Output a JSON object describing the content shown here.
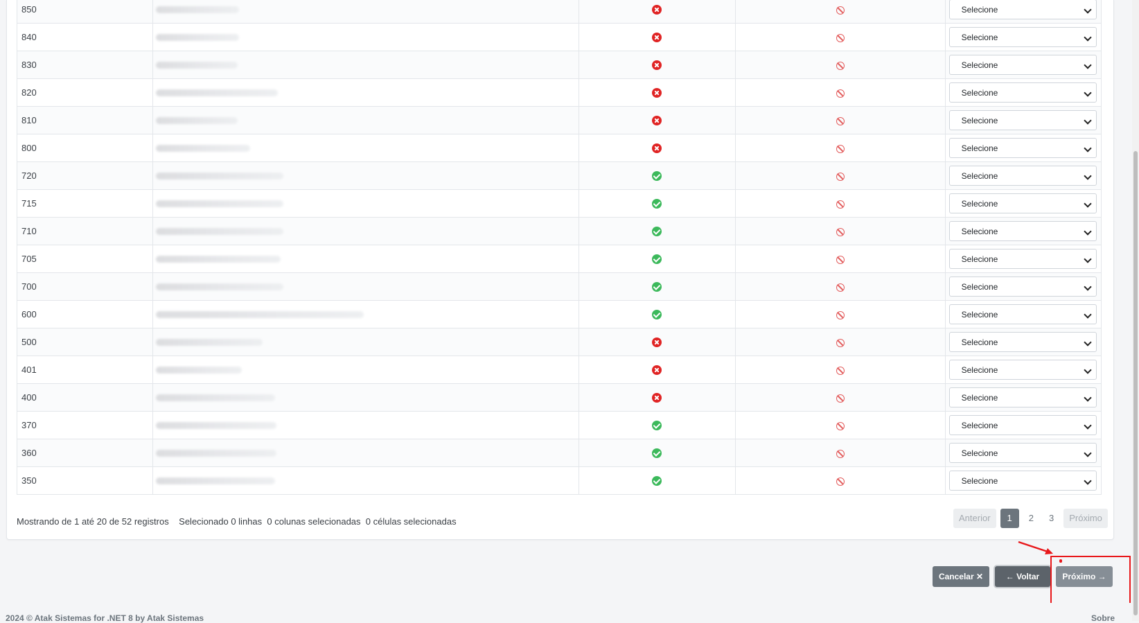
{
  "table": {
    "option_placeholder": "Selecione",
    "rows": [
      {
        "code": "850",
        "status": "error",
        "name_blur": 120
      },
      {
        "code": "840",
        "status": "error",
        "name_blur": 120
      },
      {
        "code": "830",
        "status": "error",
        "name_blur": 118
      },
      {
        "code": "820",
        "status": "error",
        "name_blur": 176
      },
      {
        "code": "810",
        "status": "error",
        "name_blur": 118
      },
      {
        "code": "800",
        "status": "error",
        "name_blur": 136
      },
      {
        "code": "720",
        "status": "ok",
        "name_blur": 184
      },
      {
        "code": "715",
        "status": "ok",
        "name_blur": 184
      },
      {
        "code": "710",
        "status": "ok",
        "name_blur": 184
      },
      {
        "code": "705",
        "status": "ok",
        "name_blur": 180
      },
      {
        "code": "700",
        "status": "ok",
        "name_blur": 184
      },
      {
        "code": "600",
        "status": "ok",
        "name_blur": 300
      },
      {
        "code": "500",
        "status": "error",
        "name_blur": 154
      },
      {
        "code": "401",
        "status": "error",
        "name_blur": 124
      },
      {
        "code": "400",
        "status": "error",
        "name_blur": 172
      },
      {
        "code": "370",
        "status": "ok",
        "name_blur": 174
      },
      {
        "code": "360",
        "status": "ok",
        "name_blur": 174
      },
      {
        "code": "350",
        "status": "ok",
        "name_blur": 172
      }
    ]
  },
  "info": {
    "showing": "Mostrando de 1 até 20 de 52 registros",
    "selected_rows": "Selecionado 0 linhas",
    "selected_cols": "0 colunas selecionadas",
    "selected_cells": "0 células selecionadas"
  },
  "pagination": {
    "prev": "Anterior",
    "pages": [
      "1",
      "2",
      "3"
    ],
    "active": "1",
    "next": "Próximo"
  },
  "actions": {
    "cancel": "Cancelar ✕",
    "back": "← Voltar",
    "next": "Próximo →"
  },
  "footer": {
    "left": "2024 © Atak Sistemas for .NET 8 by Atak Sistemas",
    "right": "Sobre"
  },
  "colors": {
    "error": "#e02424",
    "ok": "#3cb95b",
    "ban": "#e35d5d",
    "highlight": "#e8171a"
  }
}
